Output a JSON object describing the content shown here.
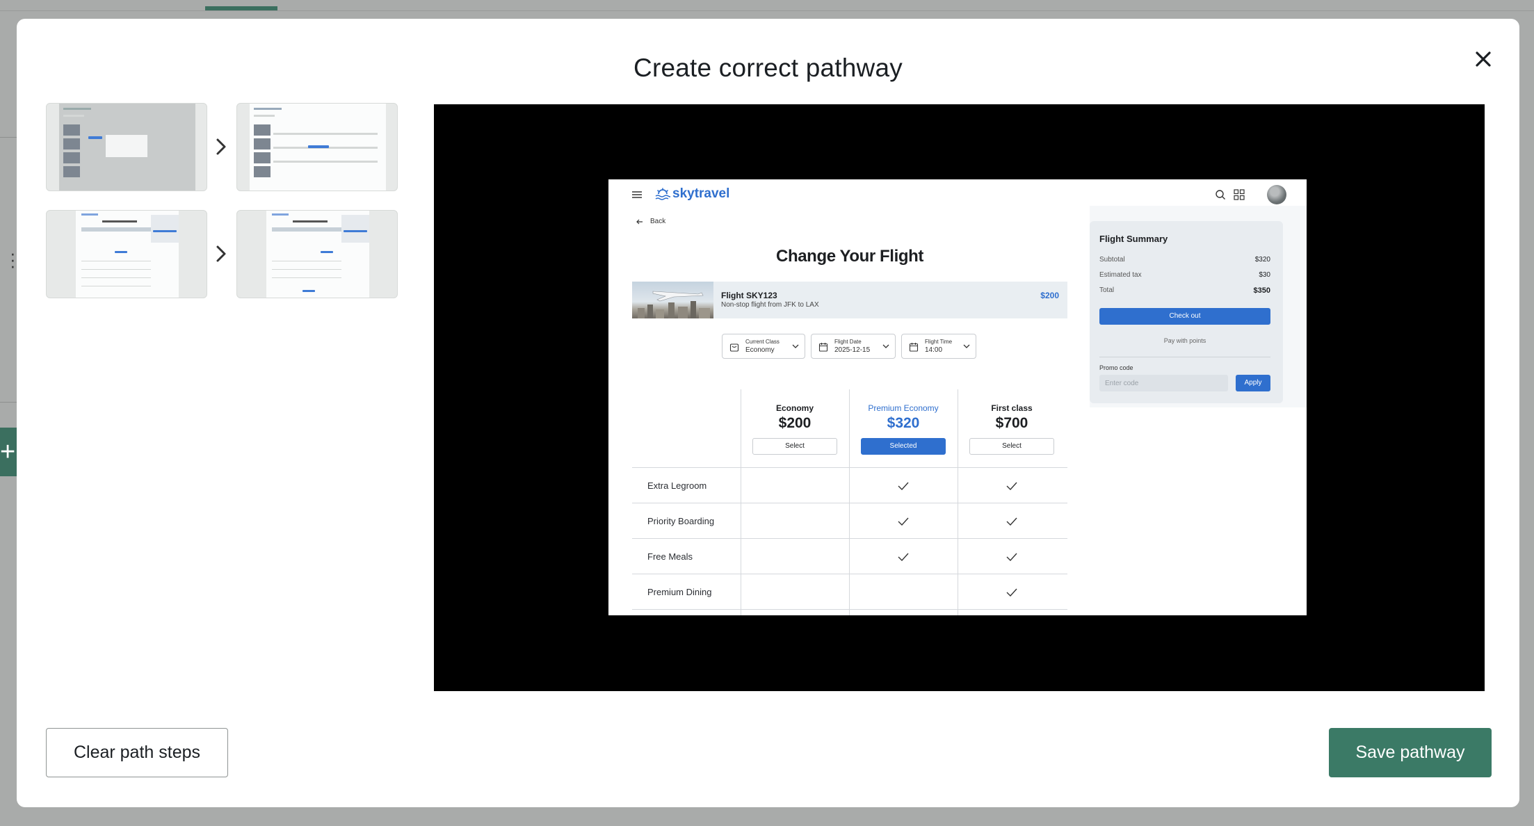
{
  "modal": {
    "title": "Create correct pathway",
    "close_icon": "close-icon",
    "clear_label": "Clear path steps",
    "save_label": "Save pathway"
  },
  "thumbnails": [
    {
      "step": 1,
      "name": "hotel-list-with-dialog"
    },
    {
      "step": 2,
      "name": "hotel-list"
    },
    {
      "step": 3,
      "name": "change-flight-economy"
    },
    {
      "step": 4,
      "name": "change-flight-premium"
    }
  ],
  "preview": {
    "brand": "skytravel",
    "back_label": "Back",
    "page_title": "Change Your Flight",
    "flight": {
      "name": "Flight SKY123",
      "route": "Non-stop flight from JFK to LAX",
      "price": "$200"
    },
    "dropdowns": [
      {
        "label": "Current Class",
        "value": "Economy",
        "icon": "bag-icon"
      },
      {
        "label": "Flight Date",
        "value": "2025-12-15",
        "icon": "calendar-icon"
      },
      {
        "label": "Flight Time",
        "value": "14:00",
        "icon": "calendar-icon"
      }
    ],
    "classes": [
      {
        "name": "Economy",
        "price": "$200",
        "button": "Select",
        "selected": false
      },
      {
        "name": "Premium Economy",
        "price": "$320",
        "button": "Selected",
        "selected": true
      },
      {
        "name": "First class",
        "price": "$700",
        "button": "Select",
        "selected": false
      }
    ],
    "features": [
      {
        "label": "Extra Legroom",
        "included": [
          false,
          true,
          true
        ]
      },
      {
        "label": "Priority Boarding",
        "included": [
          false,
          true,
          true
        ]
      },
      {
        "label": "Free Meals",
        "included": [
          false,
          true,
          true
        ]
      },
      {
        "label": "Premium Dining",
        "included": [
          false,
          false,
          true
        ]
      }
    ],
    "summary": {
      "title": "Flight Summary",
      "subtotal_label": "Subtotal",
      "subtotal": "$320",
      "tax_label": "Estimated tax",
      "tax": "$30",
      "total_label": "Total",
      "total": "$350",
      "checkout_label": "Check out",
      "pay_points_label": "Pay with points",
      "promo_label": "Promo code",
      "promo_placeholder": "Enter code",
      "apply_label": "Apply"
    }
  },
  "colors": {
    "accent_green": "#3b7a66",
    "sky_blue": "#2f6fce"
  }
}
